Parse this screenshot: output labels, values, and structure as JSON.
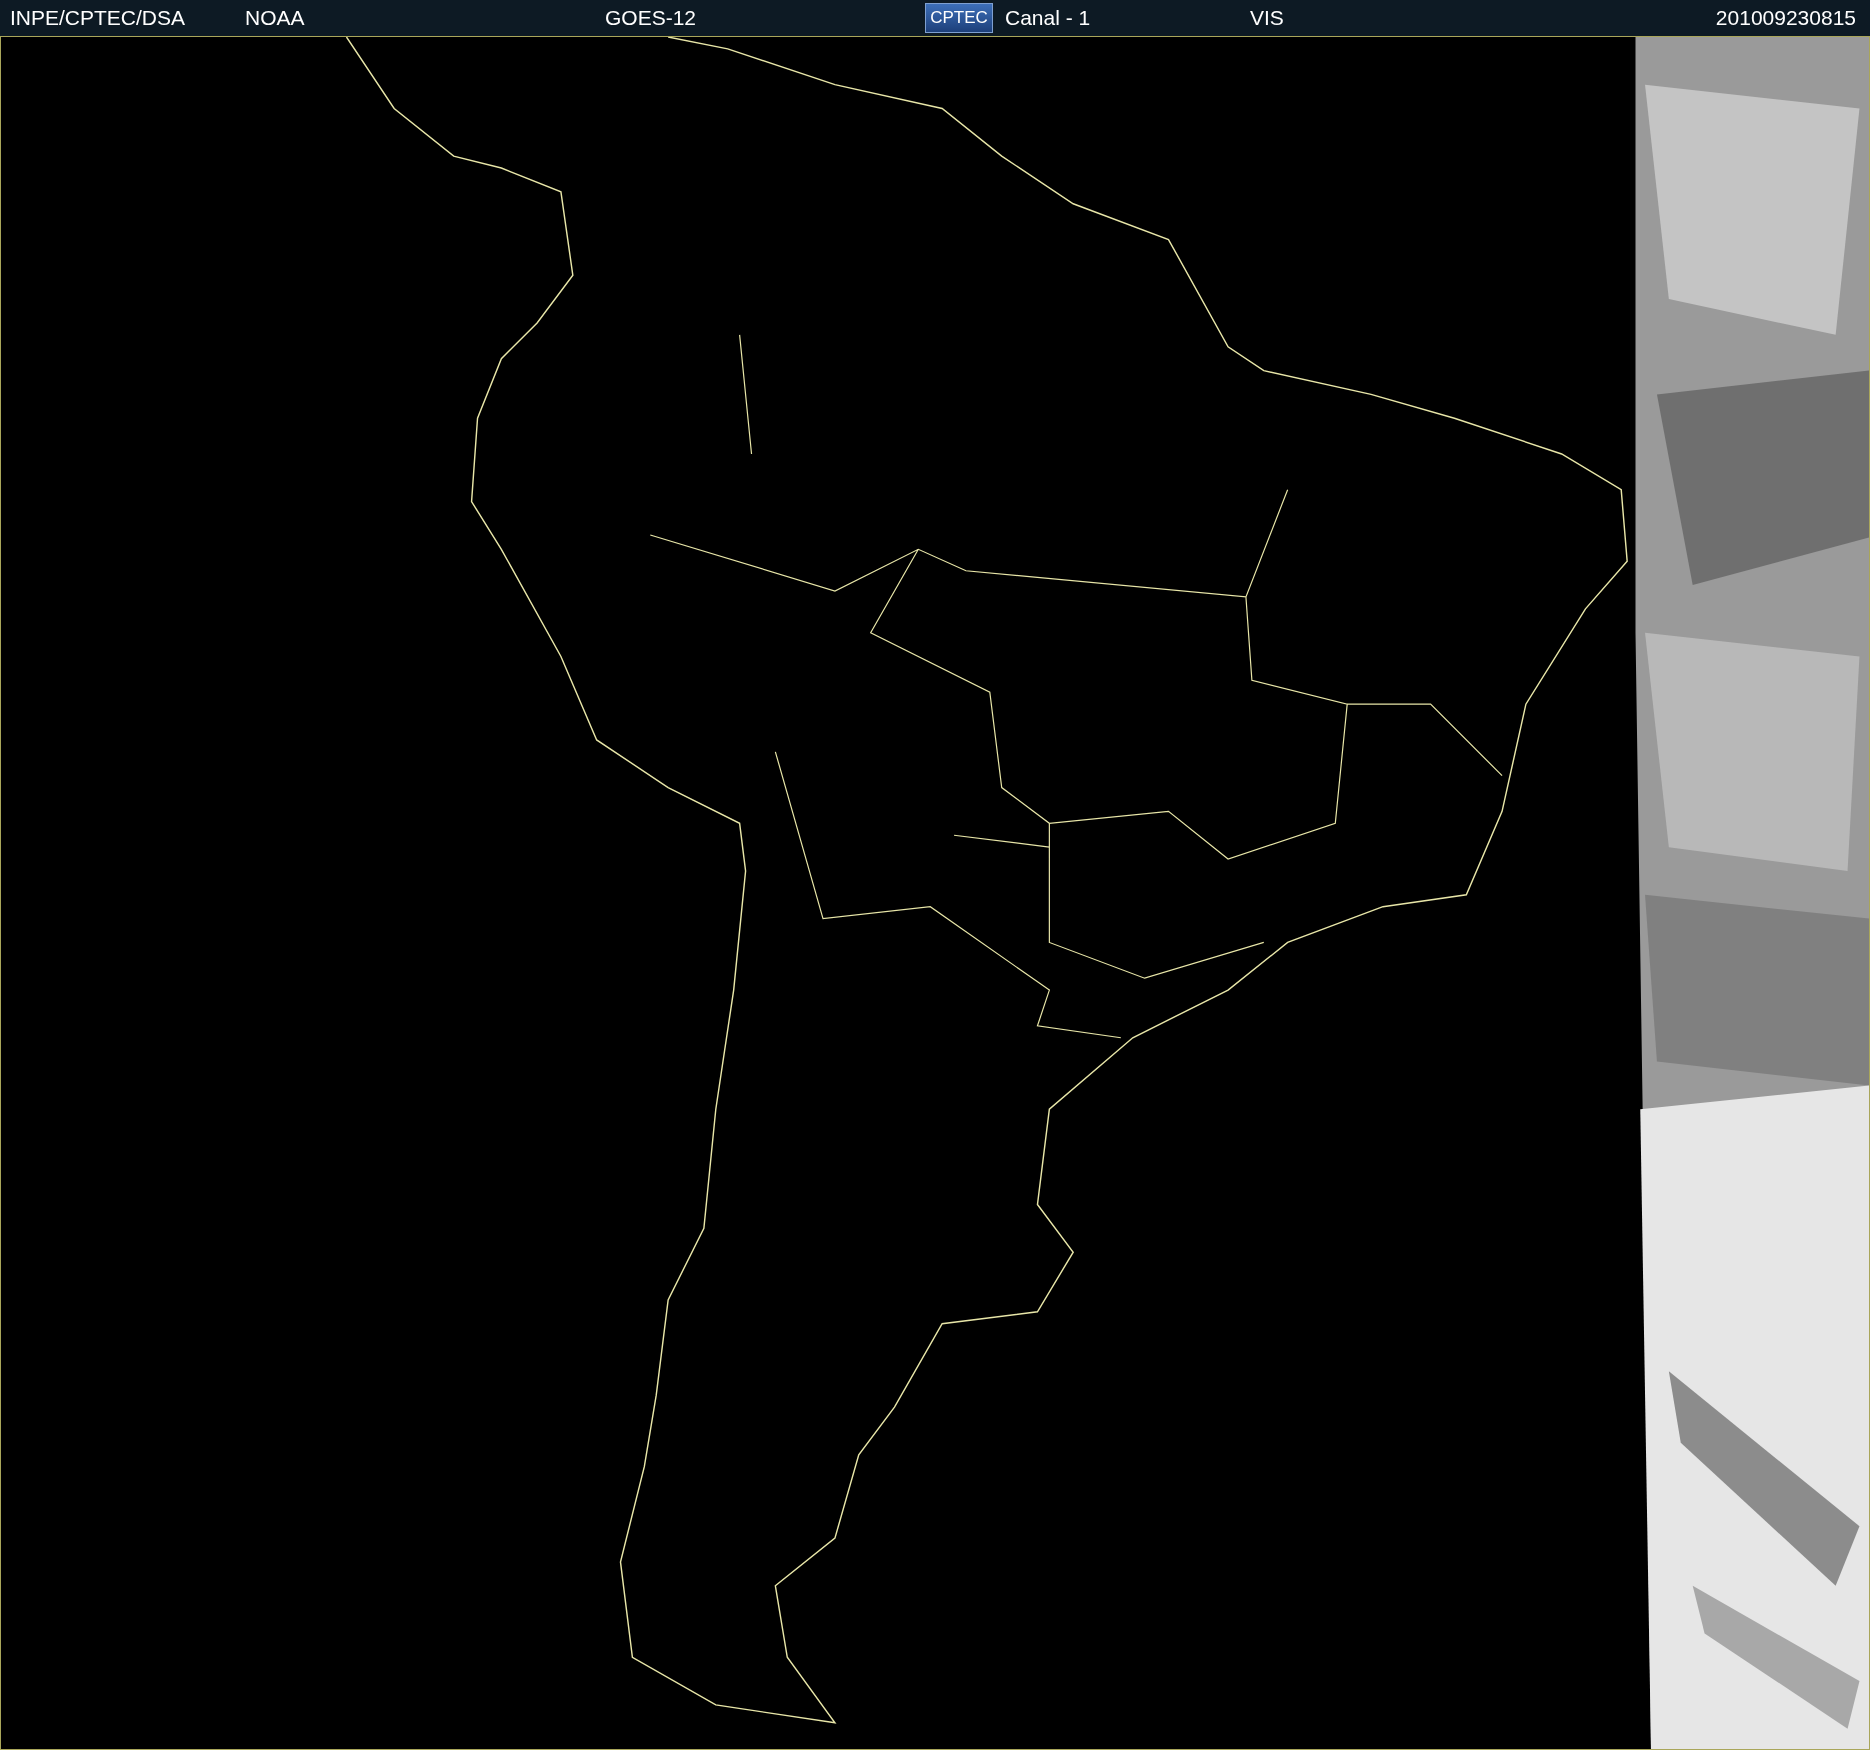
{
  "header": {
    "source": "INPE/CPTEC/DSA",
    "agency": "NOAA",
    "satellite": "GOES-12",
    "logo": "CPTEC",
    "channel": "Canal - 1",
    "band": "VIS",
    "timestamp": "201009230815"
  }
}
